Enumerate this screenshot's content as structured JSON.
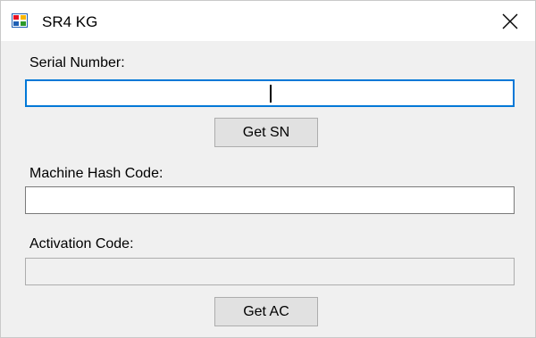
{
  "window": {
    "title": "SR4 KG",
    "icon": "app-window-icon",
    "close_icon": "close-icon"
  },
  "form": {
    "serial_label": "Serial Number:",
    "serial_value": "",
    "get_sn_label": "Get SN",
    "hash_label": "Machine Hash Code:",
    "hash_value": "",
    "activation_label": "Activation Code:",
    "activation_value": "",
    "get_ac_label": "Get AC"
  },
  "colors": {
    "focus_border": "#0078d7",
    "window_bg": "#f0f0f0",
    "button_bg": "#e1e1e1"
  }
}
